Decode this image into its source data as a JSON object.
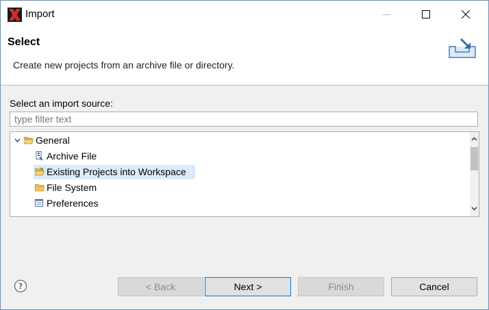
{
  "window": {
    "title": "Import"
  },
  "banner": {
    "title": "Select",
    "description": "Create new projects from an archive file or directory."
  },
  "source": {
    "label": "Select an import source:",
    "filter_placeholder": "type filter text",
    "filter_value": ""
  },
  "tree": {
    "items": [
      {
        "label": "General",
        "icon": "folder-open-icon",
        "expanded": true,
        "level": 0
      },
      {
        "label": "Archive File",
        "icon": "archive-icon",
        "level": 1
      },
      {
        "label": "Existing Projects into Workspace",
        "icon": "project-folder-icon",
        "level": 1,
        "selected": true
      },
      {
        "label": "File System",
        "icon": "folder-icon",
        "level": 1
      },
      {
        "label": "Preferences",
        "icon": "preferences-icon",
        "level": 1
      }
    ]
  },
  "buttons": {
    "back": "< Back",
    "next": "Next >",
    "finish": "Finish",
    "cancel": "Cancel"
  },
  "colors": {
    "accent": "#0078d7",
    "selection": "#ddeafb",
    "folder": "#e8b84a"
  }
}
